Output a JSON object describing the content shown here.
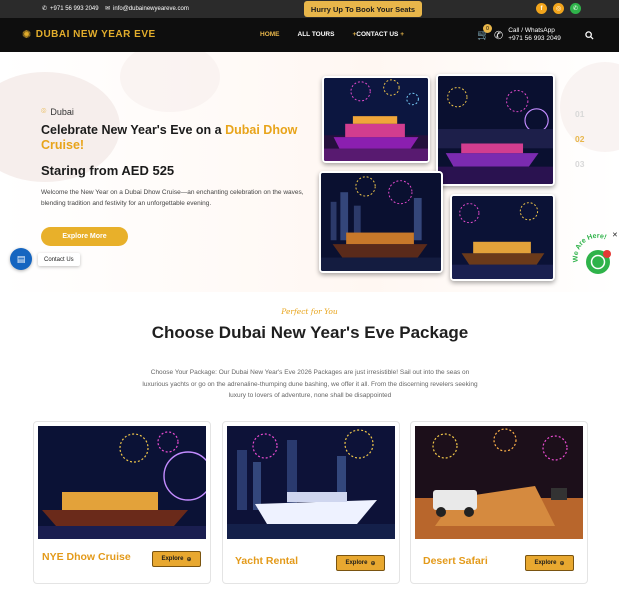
{
  "topbar": {
    "phone": "+971 56 993 2049",
    "email": "info@dubainewyeareve.com",
    "promo": "Hurry Up To Book Your Seats",
    "socials": [
      "facebook-icon",
      "instagram-icon",
      "whatsapp-icon"
    ]
  },
  "nav": {
    "logo": "DUBAI NEW YEAR EVE",
    "items": [
      {
        "label": "HOME",
        "active": true
      },
      {
        "label": "ALL TOURS",
        "active": false
      },
      {
        "label": "CONTACT US",
        "active": false
      }
    ],
    "cart_count": "0",
    "call_label": "Call / WhatsApp",
    "call_number": "+971 56 993 2049"
  },
  "hero": {
    "location": "Dubai",
    "title_pre": "Celebrate New Year's Eve on a ",
    "title_highlight": "Dubai Dhow Cruise!",
    "price": "Staring from AED 525",
    "description": "Welcome the New Year on a Dubai Dhow Cruise—an enchanting celebration on the waves, blending tradition and festivity for an unforgettable evening.",
    "cta": "Explore More",
    "steps": [
      "01",
      "02",
      "03"
    ],
    "active_step": 1
  },
  "floating": {
    "chat_label": "Contact Us",
    "whatsapp_text": "We Are Here!",
    "whatsapp_badge": "1"
  },
  "packages": {
    "kicker": "Perfect for You",
    "title": "Choose Dubai New Year's Eve Package",
    "description": "Choose Your Package: Our Dubai New Year's Eve 2026 Packages are just irresistible! Sail out into the seas on luxurious yachts or go on the adrenaline-thumping dune bashing, we offer it all. From the discerning revelers seeking luxury to lovers of adventure, none shall be disappointed",
    "cards": [
      {
        "title": "NYE Dhow Cruise",
        "button": "Explore"
      },
      {
        "title": "Yacht Rental",
        "button": "Explore"
      },
      {
        "title": "Desert Safari",
        "button": "Explore"
      }
    ]
  },
  "colors": {
    "accent": "#e8b02a",
    "title_gold": "#e39a1a",
    "dark": "#0e0e0e"
  }
}
